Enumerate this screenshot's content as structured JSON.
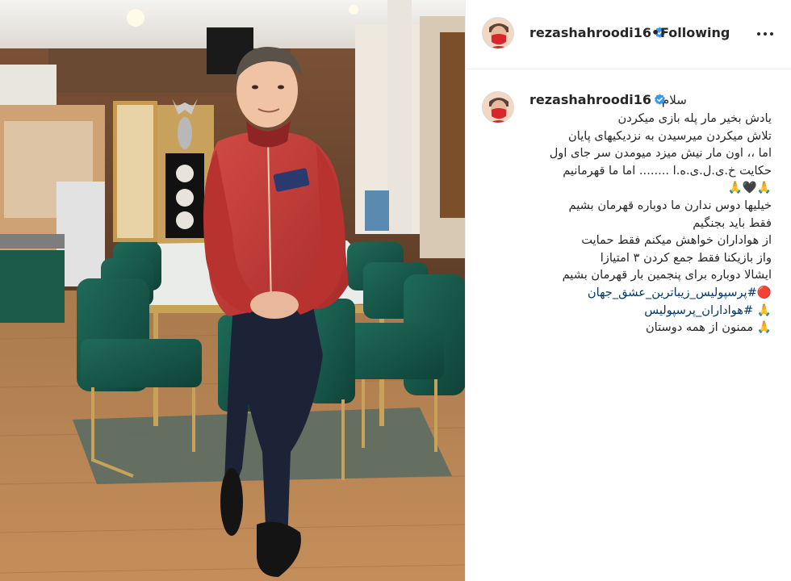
{
  "post": {
    "author": {
      "username": "rezashahroodi16",
      "verified": true,
      "avatar_icon": "profile-avatar-icon"
    },
    "header": {
      "separator": "•",
      "follow_status": "Following",
      "more_icon": "more-options-icon"
    },
    "caption": {
      "greeting": "سلام",
      "lines": [
        "یادش بخیر مار پله بازی میکردن",
        "تلاش میکردن میرسیدن به نزدیکیهای پایان",
        "اما ،، اون مار نیش میزد میومدن سر جای اول",
        "حکایت خ.ی.ل.ی.ه.ا ........ اما ما قهرمانیم",
        "🙏🖤🙏",
        "خیلیها دوس ندارن ما دوباره قهرمان بشیم",
        "فقط باید بجنگیم",
        "از هواداران خواهش میکنم فقط حمایت",
        "واز بازیکنا فقط جمع کردن ۳ امتیازا",
        "ایشالا دوباره برای پنجمین بار قهرمان بشیم"
      ],
      "hashtags": [
        "🔴#پرسپولیس_زیباترین_عشق_جهان",
        "🙏 #هواداران_پرسپولیس"
      ],
      "closing": "🙏 ممنون از همه دوستان"
    },
    "colors": {
      "verified_badge": "#3897f0",
      "hashtag": "#00376b",
      "text": "#262626"
    }
  }
}
